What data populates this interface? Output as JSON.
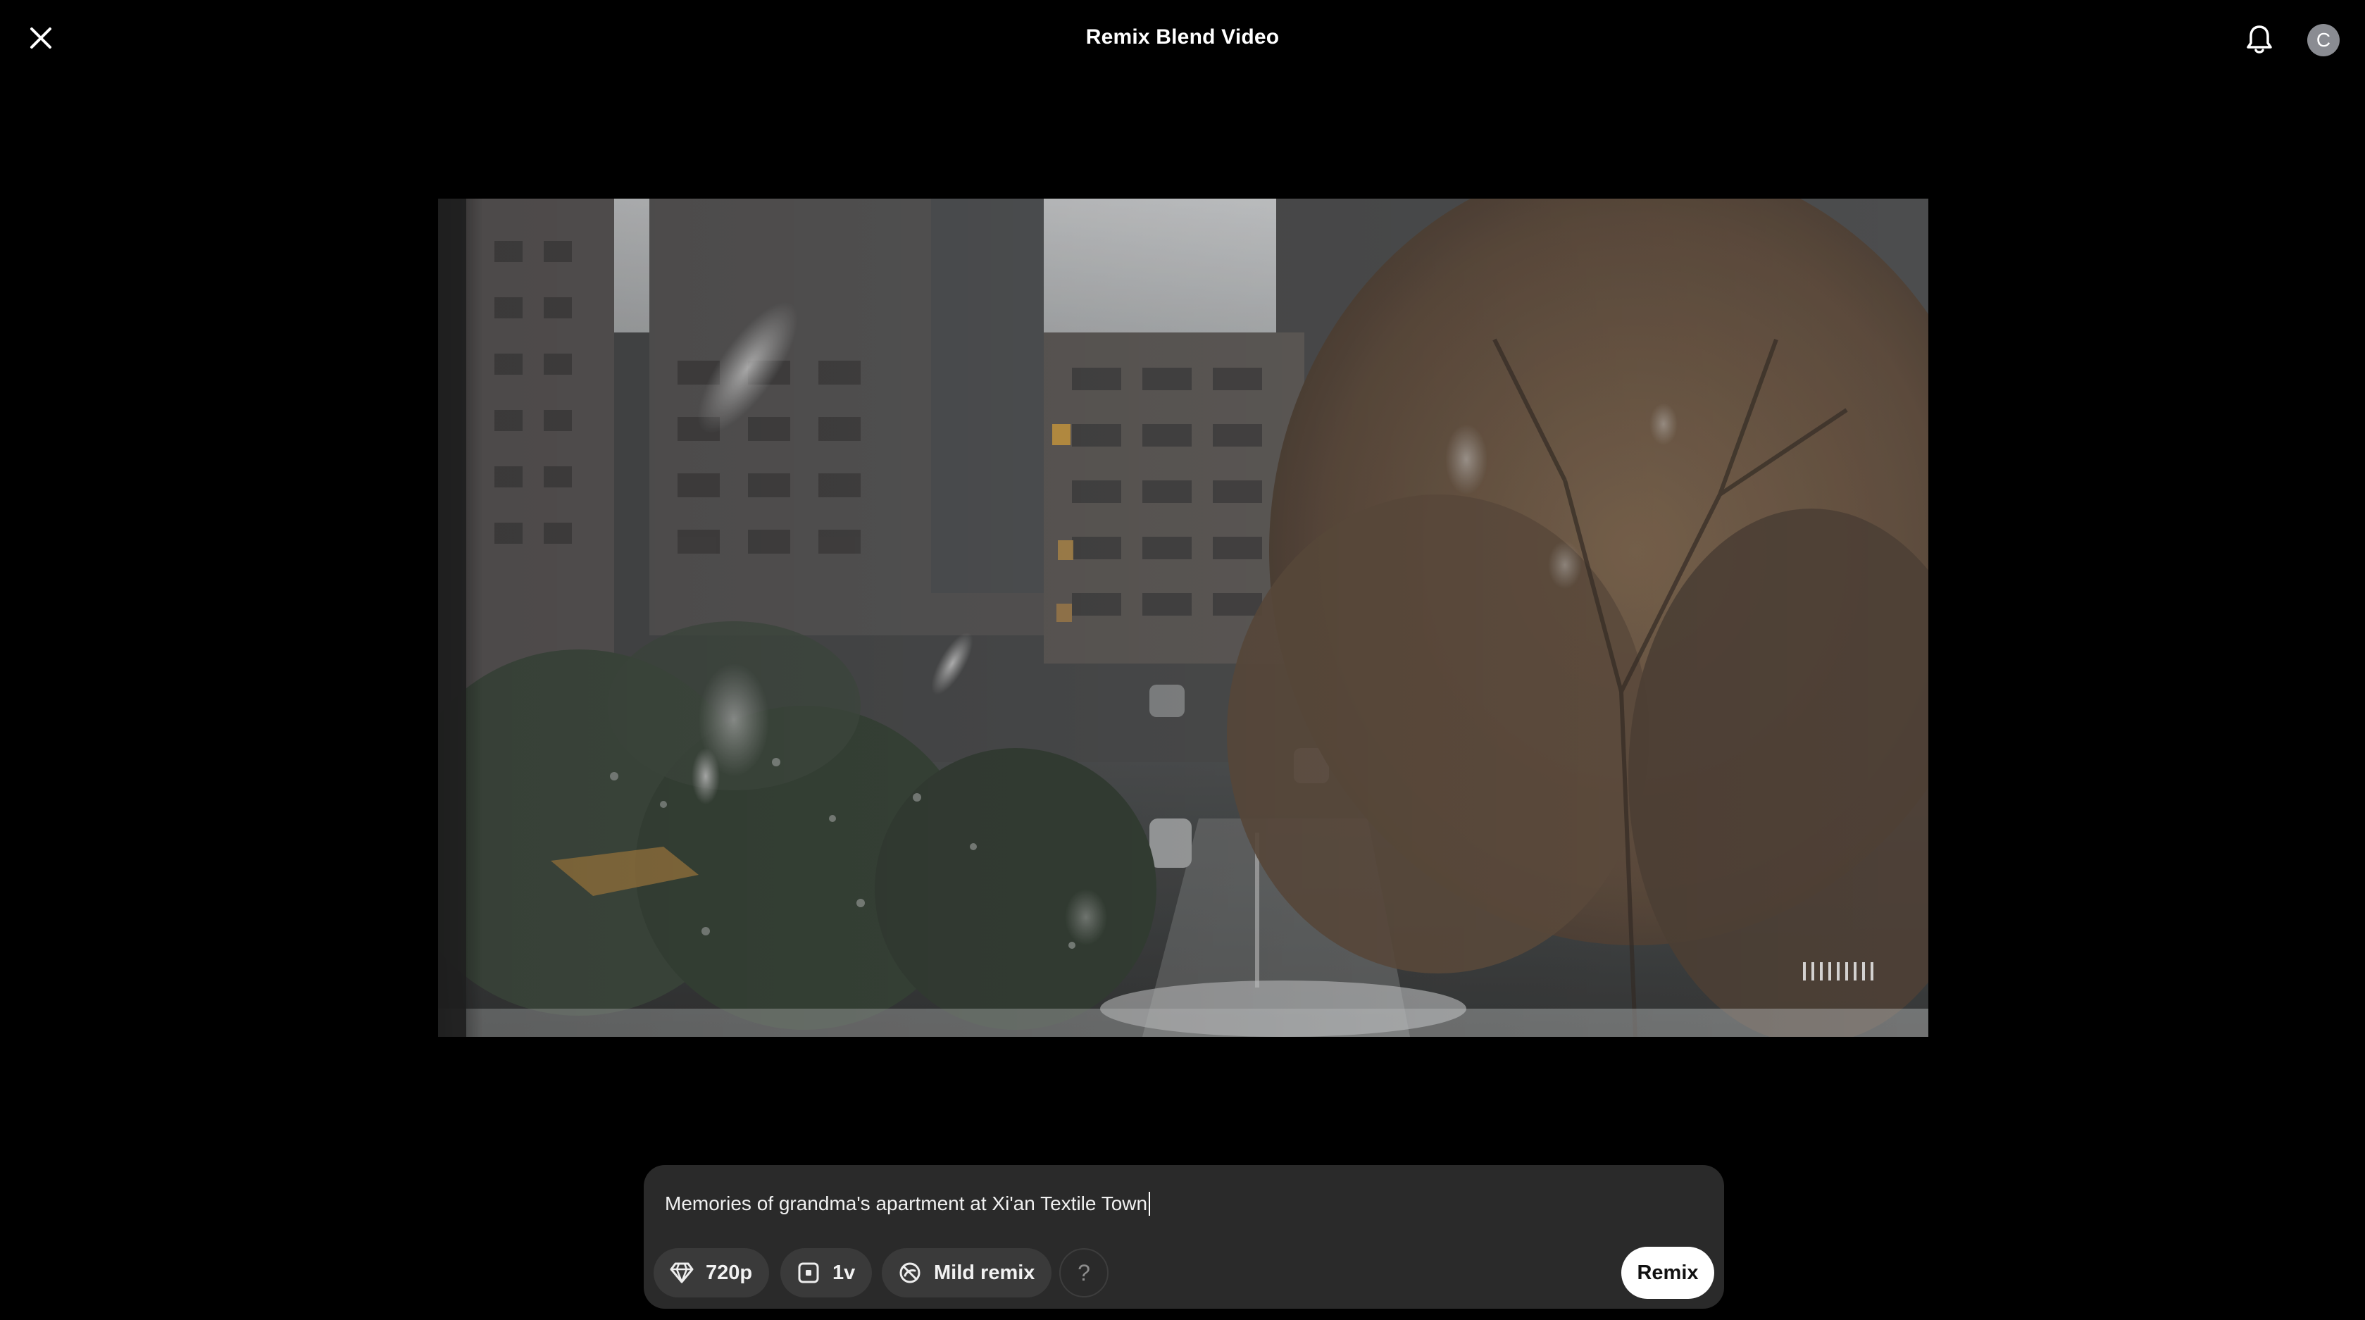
{
  "header": {
    "title": "Remix Blend Video",
    "close_icon": "close-icon",
    "notifications_icon": "bell-icon",
    "avatar_initial": "C"
  },
  "video": {
    "description_icon": "video-preview"
  },
  "composer": {
    "prompt_value": "Memories of grandma's apartment at Xi'an Textile Town",
    "options": {
      "resolution": {
        "label": "720p",
        "icon": "diamond-icon"
      },
      "variations": {
        "label": "1v",
        "icon": "variations-icon"
      },
      "remix_strength": {
        "label": "Mild remix",
        "icon": "remix-strength-icon"
      }
    },
    "help_label": "?",
    "submit_label": "Remix"
  },
  "colors": {
    "background": "#000000",
    "composer": "#2a2a2a",
    "pill": "#3a3a3a",
    "avatar": "#8a8c92",
    "button": "#ffffff"
  }
}
